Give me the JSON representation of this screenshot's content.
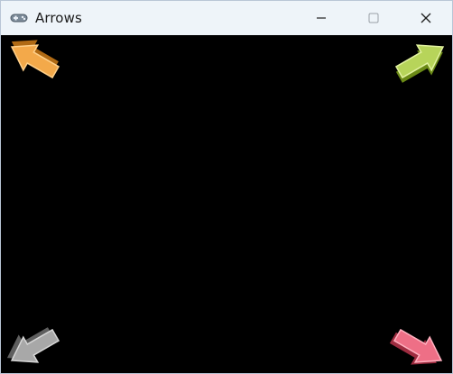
{
  "window": {
    "title": "Arrows",
    "icon": "gamepad-icon"
  },
  "controls": {
    "minimize": "minimize-icon",
    "maximize": "maximize-icon",
    "close": "close-icon"
  },
  "arrows": [
    {
      "name": "arrow-top-left",
      "direction": "up-left",
      "color": "#f3a94a"
    },
    {
      "name": "arrow-top-right",
      "direction": "up-right",
      "color": "#b7d45a"
    },
    {
      "name": "arrow-bottom-left",
      "direction": "down-left",
      "color": "#a8a8a8"
    },
    {
      "name": "arrow-bottom-right",
      "direction": "down-right",
      "color": "#ee6f86"
    }
  ]
}
